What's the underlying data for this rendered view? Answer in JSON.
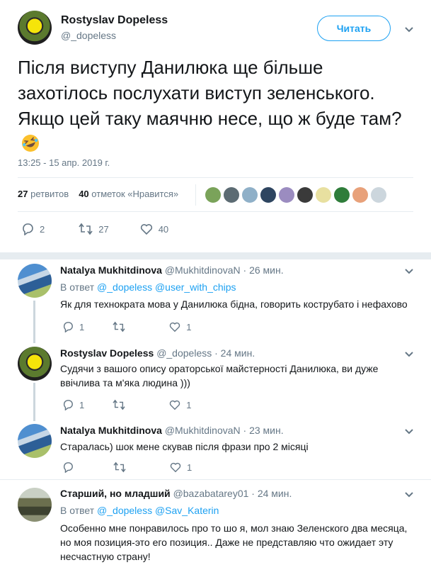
{
  "tweet": {
    "author_name": "Rostyslav Dopeless",
    "author_handle": "@_dopeless",
    "follow_label": "Читать",
    "text": "Після виступу Данилюка ще більше захотілось послухати виступ зеленського. Якщо цей таку маячню несе, що ж буде там?",
    "emoji": "rolling-on-floor-laughing-emoji",
    "timestamp": "13:25 - 15 апр. 2019 г.",
    "retweets_count": "27",
    "retweets_label": "ретвитов",
    "likes_count": "40",
    "likes_label": "отметок «Нравится»",
    "actions": {
      "replies": "2",
      "retweets": "27",
      "likes": "40"
    },
    "likers_colors": [
      "#7aa35a",
      "#5c6b73",
      "#8fb0c8",
      "#2e4560",
      "#9b8cc0",
      "#3a3a3a",
      "#e8e0a0",
      "#2f7d3a",
      "#e8a17a",
      "#ccd6dd"
    ]
  },
  "replies": [
    {
      "name": "Natalya Mukhitdinova",
      "handle": "@MukhitdinovaN",
      "time": "· 26 мин.",
      "in_reply_label": "В ответ",
      "mentions": "@_dopeless @user_with_chips",
      "text": "Як для технократа мова у Данилюка бідна, говорить кострубато і нефахово",
      "reply_count": "1",
      "like_count": "1"
    },
    {
      "name": "Rostyslav Dopeless",
      "handle": "@_dopeless",
      "time": "· 24 мин.",
      "text": "Судячи з вашого опису ораторської майстерності Данилюка, ви дуже ввічлива та м'яка людина )))",
      "reply_count": "1",
      "like_count": "1"
    },
    {
      "name": "Natalya Mukhitdinova",
      "handle": "@MukhitdinovaN",
      "time": "· 23 мин.",
      "text": "Старалась) шок мене скував після фрази про 2 місяці",
      "like_count": "1"
    },
    {
      "name": "Старший, но младший",
      "handle": "@bazabatarey01",
      "time": "· 24 мин.",
      "in_reply_label": "В ответ",
      "mentions": "@_dopeless @Sav_Katerin",
      "text": "Особенно мне понравилось про то шо я, мол знаю Зеленского два месяца, но моя позиция-это его позиция.. Даже не представляю что ожидает эту несчастную страну!"
    }
  ],
  "colors": {
    "accent": "#1da1f2",
    "muted": "#657786",
    "separator": "#e6ecf0"
  }
}
